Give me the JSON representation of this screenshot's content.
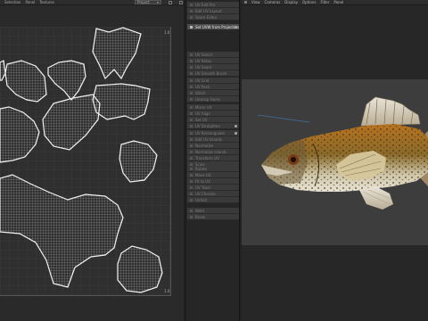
{
  "uv_editor": {
    "menu": [
      "Selection",
      "Panel",
      "Textures"
    ],
    "dropdown": "Project",
    "tick_top": "1.0",
    "tick_bottom": "1.0"
  },
  "stack": {
    "items": [
      {
        "label": "UV Edit Pro",
        "active": false
      },
      {
        "label": "Edit UV Layout",
        "active": false
      },
      {
        "label": "Seam Editor",
        "active": false
      },
      {
        "label": "Set UVW from Projection",
        "active": true,
        "toggle": true
      },
      {
        "label": "UV Select",
        "active": false
      },
      {
        "label": "UV Relax",
        "active": false
      },
      {
        "label": "UV Seam",
        "active": false
      },
      {
        "label": "UV Smooth Brush",
        "active": false
      },
      {
        "label": "UV Grid",
        "active": false
      },
      {
        "label": "UV Pack",
        "active": false
      },
      {
        "label": "Stitch",
        "active": false
      },
      {
        "label": "Unwrap Faces",
        "active": false
      },
      {
        "label": "Mirror UV",
        "active": false
      },
      {
        "label": "UV Align",
        "active": false
      },
      {
        "label": "Set UV",
        "active": false
      },
      {
        "label": "UV Straighten",
        "active": false,
        "toggle": true
      },
      {
        "label": "UV Rectangulate",
        "active": false,
        "toggle": true
      },
      {
        "label": "Edit UV Islands",
        "active": false
      },
      {
        "label": "Normalize",
        "active": false
      },
      {
        "label": "Normalize Islands",
        "active": false
      },
      {
        "label": "Transform UV",
        "active": false
      },
      {
        "label": "Scale",
        "active": false
      },
      {
        "label": "Rotate",
        "active": false
      },
      {
        "label": "Move UV",
        "active": false
      },
      {
        "label": "Fit to UV",
        "active": false
      },
      {
        "label": "UV Texel",
        "active": false
      },
      {
        "label": "UV Checker",
        "active": false
      },
      {
        "label": "Unfold",
        "active": false
      },
      {
        "label": "Weld",
        "active": false
      },
      {
        "label": "Break",
        "active": false
      }
    ]
  },
  "viewport": {
    "menu": [
      "View",
      "Cameras",
      "Display",
      "Options",
      "Filter",
      "Panel"
    ]
  }
}
